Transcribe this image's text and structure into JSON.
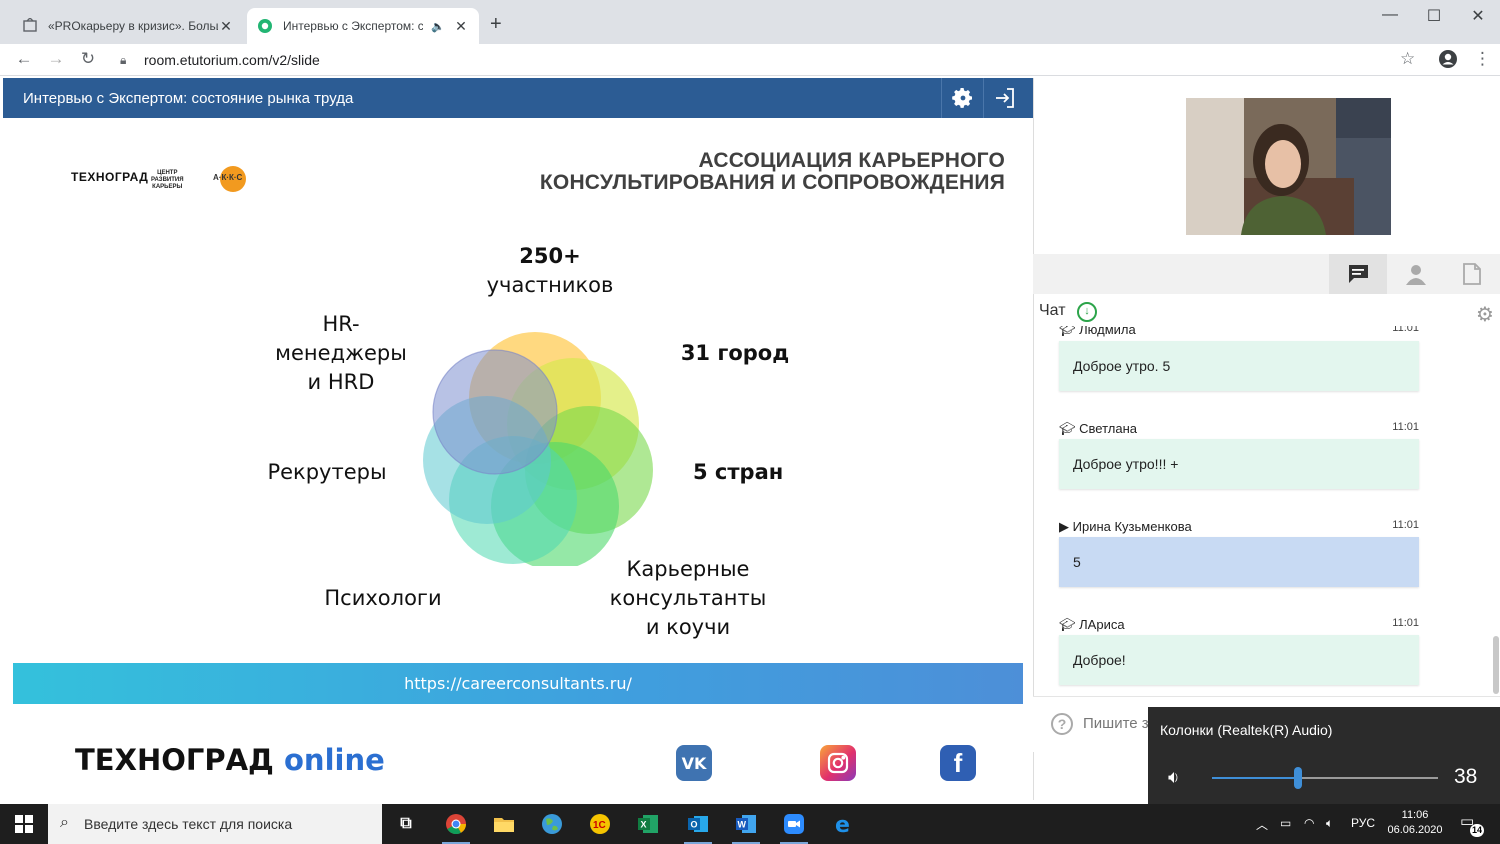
{
  "browser": {
    "tabs": [
      {
        "title": "«PROкарьеру в кризис». Больше",
        "active": false
      },
      {
        "title": "Интервью с Экспертом: сос",
        "active": true
      }
    ],
    "new_tab": "+",
    "url": "room.etutorium.com/v2/slide",
    "window_controls": {
      "minimize": "—",
      "maximize": "☐",
      "close": "✕"
    }
  },
  "slide_header": {
    "title": "Интервью с Экспертом: состояние рынка труда",
    "icons": [
      "gear-icon",
      "exit-icon"
    ]
  },
  "slide": {
    "logo_small": "ТЕХНОГРАД",
    "logo_crc": [
      "ЦЕНТР",
      "РАЗВИТИЯ",
      "КАРЬЕРЫ"
    ],
    "logo_akks": "А·К·К·С",
    "assoc_line1": "АССОЦИАЦИЯ КАРЬЕРНОГО",
    "assoc_line2": "КОНСУЛЬТИРОВАНИЯ И СОПРОВОЖДЕНИЯ",
    "stat_members_num": "250+",
    "stat_members_text": "участников",
    "stat_cities": "31 город",
    "stat_countries": "5 стран",
    "label_hr_1": "HR-",
    "label_hr_2": "менеджеры",
    "label_hr_3": "и HRD",
    "label_recruiters": "Рекрутеры",
    "label_psych": "Психологи",
    "label_career_1": "Карьерные",
    "label_career_2": "консультанты",
    "label_career_3": "и коучи",
    "site_url": "https://careerconsultants.ru/",
    "brand_main": "ТЕХНОГРАД",
    "brand_online": "online"
  },
  "right_panel": {
    "chat_title": "Чат",
    "messages": [
      {
        "author": "Людмила",
        "time": "11:01",
        "text": "Доброе утро. 5",
        "role": "student"
      },
      {
        "author": "Светлана",
        "time": "11:01",
        "text": "Доброе утро!!! +",
        "role": "student"
      },
      {
        "author": "Ирина Кузьменкова",
        "time": "11:01",
        "text": "5",
        "role": "presenter"
      },
      {
        "author": "ЛАриса",
        "time": "11:01",
        "text": "Доброе!",
        "role": "student"
      }
    ],
    "input_placeholder": "Пишите з"
  },
  "volume_popup": {
    "device": "Колонки (Realtek(R) Audio)",
    "level": 38
  },
  "taskbar": {
    "search_placeholder": "Введите здесь текст для поиска",
    "lang": "РУС",
    "time": "11:06",
    "date": "06.06.2020",
    "notifications": "14"
  },
  "colors": {
    "slide_header_bg": "#2c5c94",
    "chat_bubble": "#e3f6ee",
    "presenter_bubble": "#c8daf3",
    "accent_blue": "#2b6fd1"
  }
}
